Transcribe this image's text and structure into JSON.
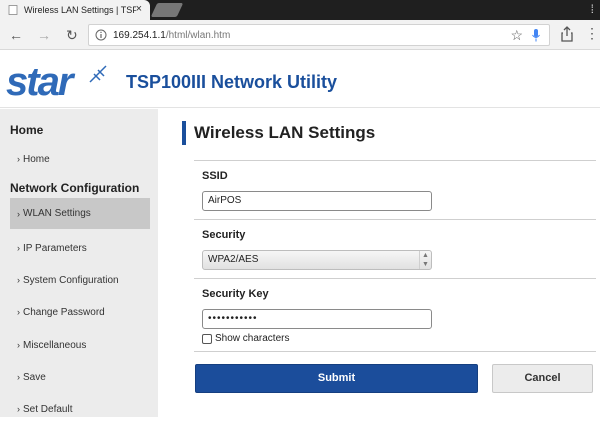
{
  "browser": {
    "tab_title": "Wireless LAN Settings | TSP",
    "tab_close": "×",
    "url_host": "169.254.1.1",
    "url_path": "/html/wlan.htm",
    "back_icon": "←",
    "forward_icon": "→",
    "reload_icon": "↻",
    "star_icon": "☆",
    "more_icon": "⋮",
    "tabbar_menu_icon": "⁞"
  },
  "header": {
    "logo_text": "star",
    "app_title": "TSP100III Network Utility",
    "brand_color": "#2f6ab8"
  },
  "sidebar": {
    "heading_home": "Home",
    "heading_network": "Network Configuration",
    "items": [
      {
        "label": "Home"
      },
      {
        "label": "WLAN Settings"
      },
      {
        "label": "IP Parameters"
      },
      {
        "label": "System Configuration"
      },
      {
        "label": "Change Password"
      },
      {
        "label": "Miscellaneous"
      },
      {
        "label": "Save"
      },
      {
        "label": "Set Default"
      }
    ],
    "chevron": "›"
  },
  "main": {
    "page_title": "Wireless LAN Settings",
    "ssid_label": "SSID",
    "ssid_value": "AirPOS",
    "security_label": "Security",
    "security_value": "WPA2/AES",
    "security_key_label": "Security Key",
    "security_key_value": "•••••••••••",
    "show_characters_label": "Show characters",
    "submit_label": "Submit",
    "cancel_label": "Cancel",
    "accent_color": "#1b4d9b"
  }
}
